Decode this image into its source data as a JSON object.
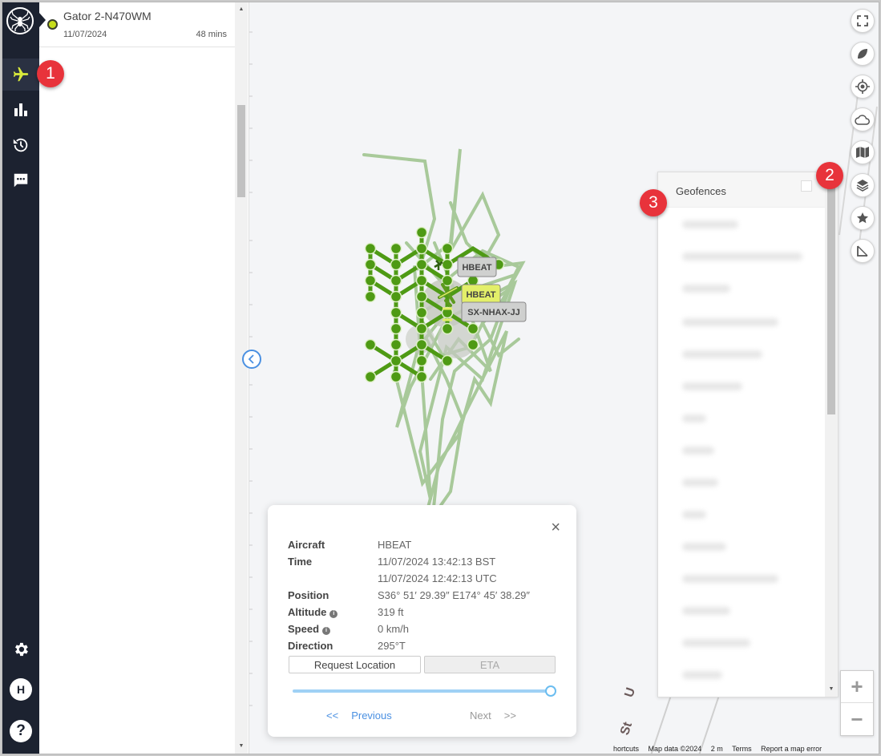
{
  "flight_list": {
    "items": [
      {
        "name": "Gator 2-N470WM",
        "date": "11/07/2024",
        "duration": "48 mins"
      }
    ]
  },
  "nav": {
    "items": [
      "aircraft",
      "stats",
      "history",
      "messages"
    ],
    "user_initial": "H",
    "help": "?"
  },
  "callouts": [
    "1",
    "2",
    "3"
  ],
  "map": {
    "labels": {
      "hbeat_1": "HBEAT",
      "hbeat_active": "HBEAT",
      "sx": "SX-NHAX-JJ"
    },
    "road_labels": [
      "St",
      "U"
    ],
    "track_color": "#9bc28a",
    "point_color": "#4e9a14",
    "highlight_color": "#e3ef69"
  },
  "geofences": {
    "title": "Geofences"
  },
  "popup": {
    "close": "×",
    "rows": [
      {
        "label": "Aircraft",
        "value": "HBEAT"
      },
      {
        "label": "Time",
        "value": "11/07/2024 13:42:13 BST"
      },
      {
        "label": "",
        "value": "11/07/2024 12:42:13 UTC"
      },
      {
        "label": "Position",
        "value": "S36° 51′ 29.39″ E174° 45′ 38.29″"
      },
      {
        "label": "Altitude",
        "value": "319 ft"
      },
      {
        "label": "Speed",
        "value": "0 km/h"
      },
      {
        "label": "Direction",
        "value": "295°T"
      }
    ],
    "request_location": "Request Location",
    "eta": "ETA",
    "prev_arrows": "<<",
    "prev": "Previous",
    "next": "Next",
    "next_arrows": ">>"
  },
  "attribution": {
    "shortcuts": "hortcuts",
    "map_data": "Map data ©2024",
    "scale": "2 m",
    "terms": "Terms",
    "report": "Report a map error"
  }
}
